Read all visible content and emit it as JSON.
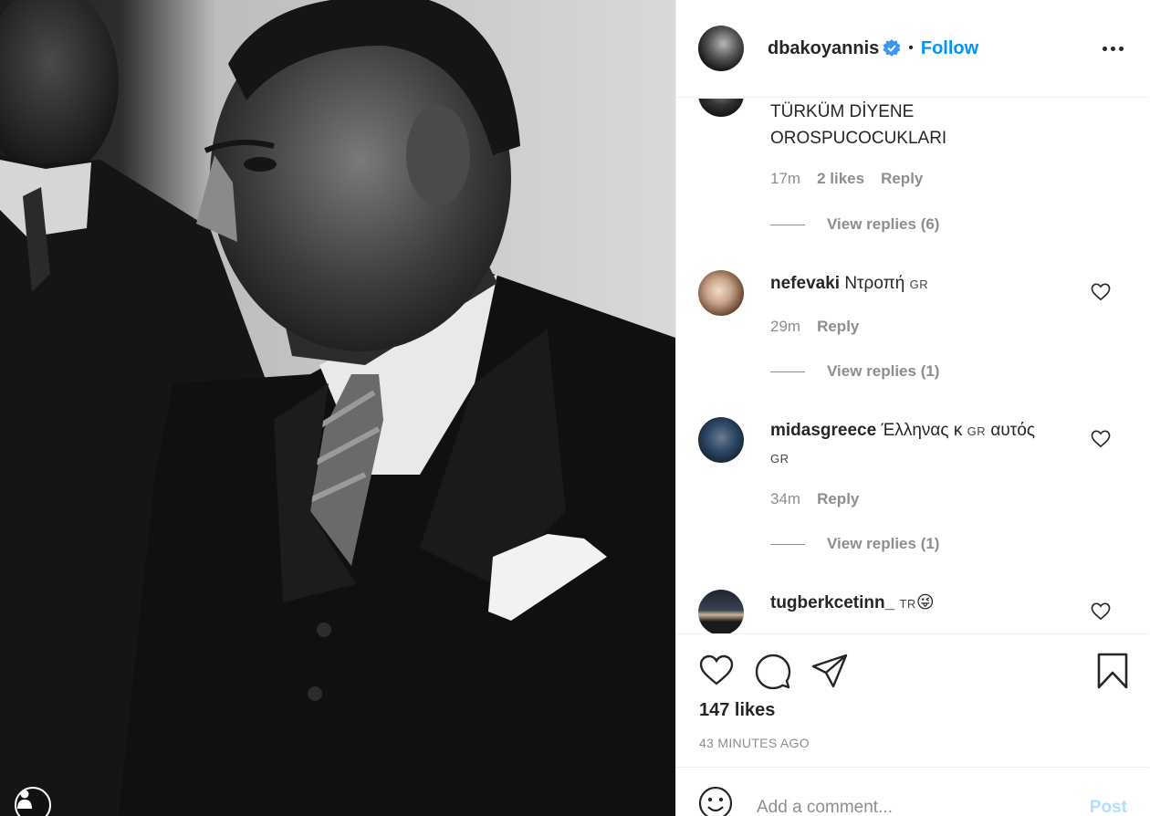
{
  "post": {
    "username": "dbakoyannis",
    "verified": true,
    "follow_label": "Follow",
    "separator": "•",
    "more_icon": "more-options-icon",
    "likes": "147 likes",
    "time_ago": "43 MINUTES AGO"
  },
  "comments": [
    {
      "username": "",
      "text_line1": "TÜRKÜM DİYENE",
      "text_line2": "OROSPUCOCUKLARI",
      "time": "17m",
      "likes": "2 likes",
      "reply_label": "Reply",
      "view_replies": "View replies (6)"
    },
    {
      "username": "nefevaki",
      "text": "Ντροπή",
      "flag": "GR",
      "time": "29m",
      "reply_label": "Reply",
      "view_replies": "View replies (1)"
    },
    {
      "username": "midasgreece",
      "text_a": "Έλληνας κ",
      "flag_a": "GR",
      "text_b": "αυτός",
      "flag_b": "GR",
      "time": "34m",
      "reply_label": "Reply",
      "view_replies": "View replies (1)"
    },
    {
      "username": "tugberkcetinn_",
      "flag": "TR",
      "emoji": "😜"
    }
  ],
  "add_comment": {
    "placeholder": "Add a comment...",
    "post_label": "Post"
  },
  "colors": {
    "accent": "#0095f6",
    "post_disabled": "#b2dffc",
    "muted": "#8e8e8e"
  }
}
